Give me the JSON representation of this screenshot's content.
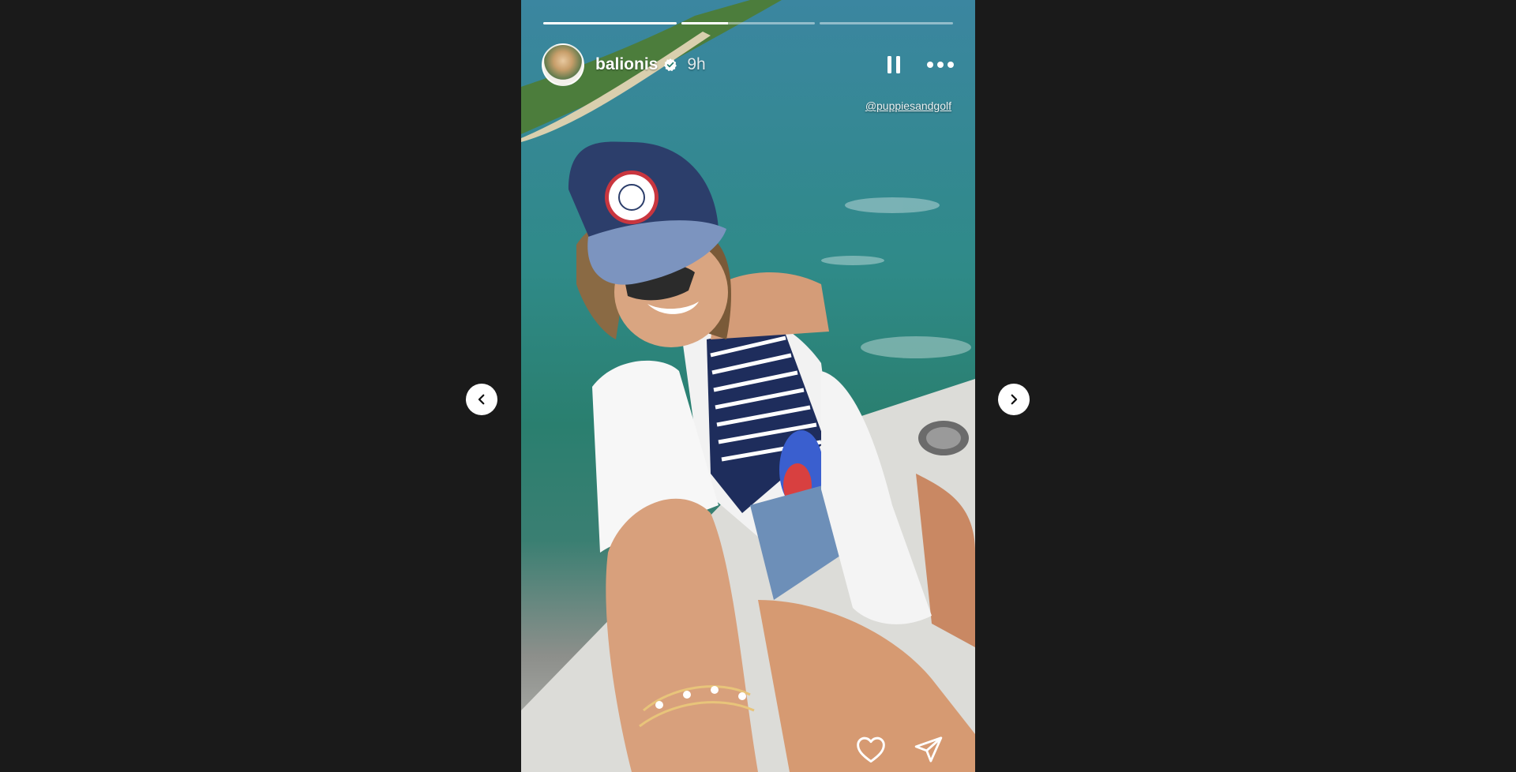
{
  "story": {
    "username": "balionis",
    "posted_ago": "9h",
    "verified": true,
    "mention": "@puppiesandgolf",
    "progress": [
      1.0,
      0.35,
      0.0
    ]
  },
  "controls": {
    "pause_icon": "pause-icon",
    "more_icon": "more-options-icon",
    "like_icon": "heart-icon",
    "share_icon": "send-icon",
    "prev_icon": "chevron-left-icon",
    "next_icon": "chevron-right-icon"
  },
  "colors": {
    "background": "#1a1a1a",
    "sea": "#2f8a88",
    "hat_navy": "#2c3e6b",
    "shirt_white": "#f5f5f5"
  }
}
